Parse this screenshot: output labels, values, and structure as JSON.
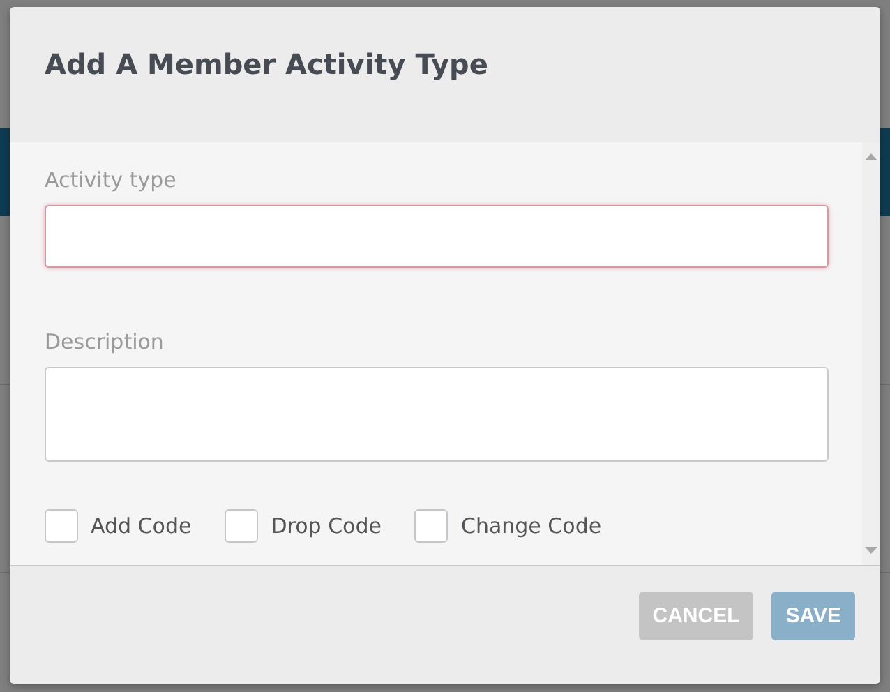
{
  "dialog": {
    "title": "Add A Member Activity Type",
    "fields": [
      {
        "label": "Activity type",
        "kind": "input",
        "invalid": true
      },
      {
        "label": "Description",
        "kind": "textarea",
        "invalid": false
      }
    ],
    "checkboxes": [
      {
        "label": "Add Code",
        "checked": false
      },
      {
        "label": "Drop Code",
        "checked": false
      },
      {
        "label": "Change Code",
        "checked": false
      }
    ],
    "buttons": [
      {
        "label": "CANCEL",
        "kind": "secondary"
      },
      {
        "label": "SAVE",
        "kind": "primary"
      }
    ]
  }
}
